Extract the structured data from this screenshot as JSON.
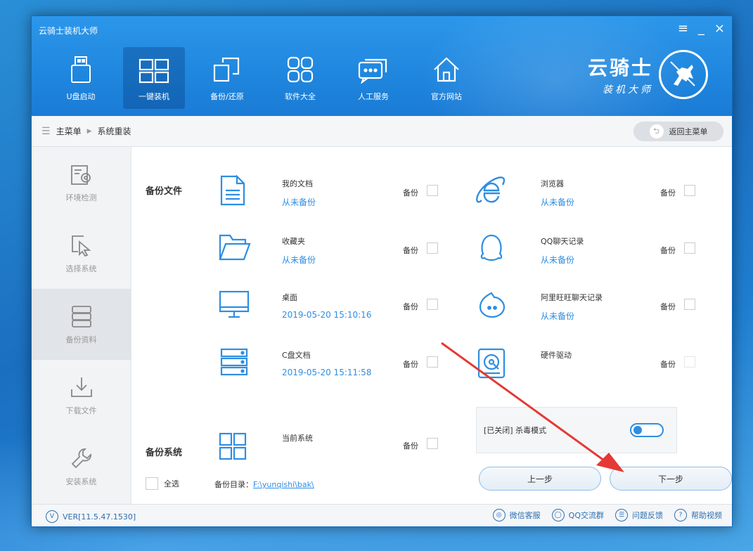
{
  "window": {
    "title": "云骑士装机大师",
    "controls": [
      "≡",
      "_",
      "×"
    ]
  },
  "nav": [
    {
      "label": "U盘启动",
      "icon": "usb-drive-icon"
    },
    {
      "label": "一键装机",
      "icon": "windows-icon",
      "active": true
    },
    {
      "label": "备份/还原",
      "icon": "backup-restore-icon"
    },
    {
      "label": "软件大全",
      "icon": "apps-grid-icon"
    },
    {
      "label": "人工服务",
      "icon": "chat-bubble-icon"
    },
    {
      "label": "官方网站",
      "icon": "home-icon"
    }
  ],
  "brand": {
    "line1": "云骑士",
    "line2": "装机大师",
    "logo": "knight-logo"
  },
  "breadcrumb": {
    "root": "主菜单",
    "current": "系统重装",
    "back_label": "返回主菜单"
  },
  "sidebar": [
    {
      "label": "环境检测",
      "icon": "environment-check-icon"
    },
    {
      "label": "选择系统",
      "icon": "cursor-select-icon"
    },
    {
      "label": "备份资料",
      "icon": "database-icon",
      "active": true
    },
    {
      "label": "下载文件",
      "icon": "download-icon"
    },
    {
      "label": "安装系统",
      "icon": "wrench-icon"
    }
  ],
  "backup_files": {
    "section_label": "备份文件",
    "backup_label": "备份",
    "left": [
      {
        "name": "我的文档",
        "status": "从未备份",
        "icon": "document-icon"
      },
      {
        "name": "收藏夹",
        "status": "从未备份",
        "icon": "folder-icon"
      },
      {
        "name": "桌面",
        "status": "2019-05-20 15:10:16",
        "icon": "monitor-icon"
      },
      {
        "name": "C盘文档",
        "status": "2019-05-20 15:11:58",
        "icon": "server-drive-icon"
      }
    ],
    "right": [
      {
        "name": "浏览器",
        "status": "从未备份",
        "icon": "ie-browser-icon"
      },
      {
        "name": "QQ聊天记录",
        "status": "从未备份",
        "icon": "qq-penguin-icon"
      },
      {
        "name": "阿里旺旺聊天记录",
        "status": "从未备份",
        "icon": "aliwangwang-icon"
      },
      {
        "name": "硬件驱动",
        "status": "",
        "icon": "hardware-driver-icon"
      }
    ]
  },
  "backup_system": {
    "section_label": "备份系统",
    "name": "当前系统",
    "backup_label": "备份",
    "icon": "windows-icon"
  },
  "antivirus": {
    "text": "[已关闭] 杀毒模式",
    "enabled": true
  },
  "footer": {
    "select_all": "全选",
    "dir_label": "备份目录：",
    "dir_path": "F:\\yunqishi\\bak\\",
    "prev_label": "上一步",
    "next_label": "下一步"
  },
  "statusbar": {
    "version": "VER[11.5.47.1530]",
    "links": [
      {
        "label": "微信客服",
        "icon": "wechat-icon"
      },
      {
        "label": "QQ交流群",
        "icon": "qq-icon"
      },
      {
        "label": "问题反馈",
        "icon": "feedback-icon"
      },
      {
        "label": "帮助视频",
        "icon": "help-icon"
      }
    ]
  },
  "colors": {
    "accent": "#2e8ee2",
    "header": "#1f86de",
    "arrow": "#e53935"
  }
}
